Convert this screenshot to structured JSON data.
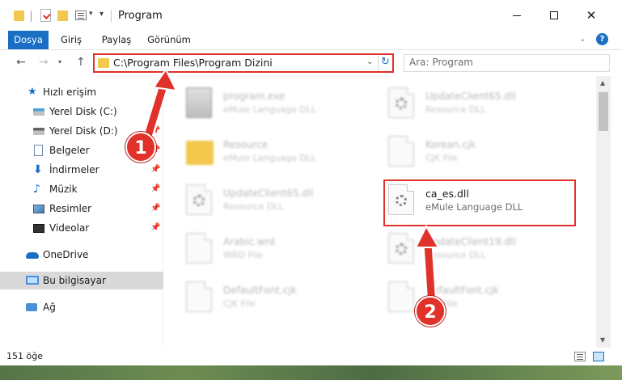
{
  "window": {
    "title": "Program"
  },
  "ribbon": {
    "tabs": [
      "Dosya",
      "Giriş",
      "Paylaş",
      "Görünüm"
    ],
    "active_tab": "Dosya",
    "help": "?"
  },
  "navigation": {
    "address": "C:\\Program Files\\Program Dizini",
    "search_placeholder": "Ara: Program"
  },
  "sidebar": {
    "quick_access": "Hızlı erişim",
    "items": [
      {
        "label": "Yerel Disk (C:)",
        "icon": "drive-c-icon",
        "pinned": true
      },
      {
        "label": "Yerel Disk (D:)",
        "icon": "drive-d-icon",
        "pinned": true
      },
      {
        "label": "Belgeler",
        "icon": "documents-icon",
        "pinned": true
      },
      {
        "label": "İndirmeler",
        "icon": "downloads-icon",
        "pinned": true
      },
      {
        "label": "Müzik",
        "icon": "music-icon",
        "pinned": true
      },
      {
        "label": "Resimler",
        "icon": "pictures-icon",
        "pinned": true
      },
      {
        "label": "Videolar",
        "icon": "videos-icon",
        "pinned": true
      }
    ],
    "onedrive": "OneDrive",
    "this_pc": "Bu bilgisayar",
    "network": "Ağ"
  },
  "files": [
    {
      "name": "program.exe",
      "type": "eMule Language DLL",
      "icon": "exe-icon"
    },
    {
      "name": "UpdateClient65.dll",
      "type": "Resource DLL",
      "icon": "dll-icon"
    },
    {
      "name": "Resource",
      "type": "eMule Language DLL",
      "icon": "folder-icon"
    },
    {
      "name": "Korean.cjk",
      "type": "CJK File",
      "icon": "file-icon"
    },
    {
      "name": "UpdateClient65.dll",
      "type": "Resource DLL",
      "icon": "dll-icon"
    },
    {
      "name": "ca_es.dll",
      "type": "eMule Language DLL",
      "icon": "dll-icon",
      "highlighted": true
    },
    {
      "name": "Arabic.wrd",
      "type": "WRD File",
      "icon": "file-icon"
    },
    {
      "name": "UpdateClient19.dll",
      "type": "Resource DLL",
      "icon": "dll-icon"
    },
    {
      "name": "DefaultFont.cjk",
      "type": "CJK File",
      "icon": "file-icon"
    },
    {
      "name": "DefaultFont.cjk",
      "type": "CJK File",
      "icon": "file-icon"
    }
  ],
  "status": {
    "item_count": "151 öğe"
  },
  "annotations": {
    "step1": "1",
    "step2": "2",
    "highlight_color": "#e0312b"
  },
  "colors": {
    "accent": "#1a6fc4",
    "highlight": "#e0312b"
  }
}
